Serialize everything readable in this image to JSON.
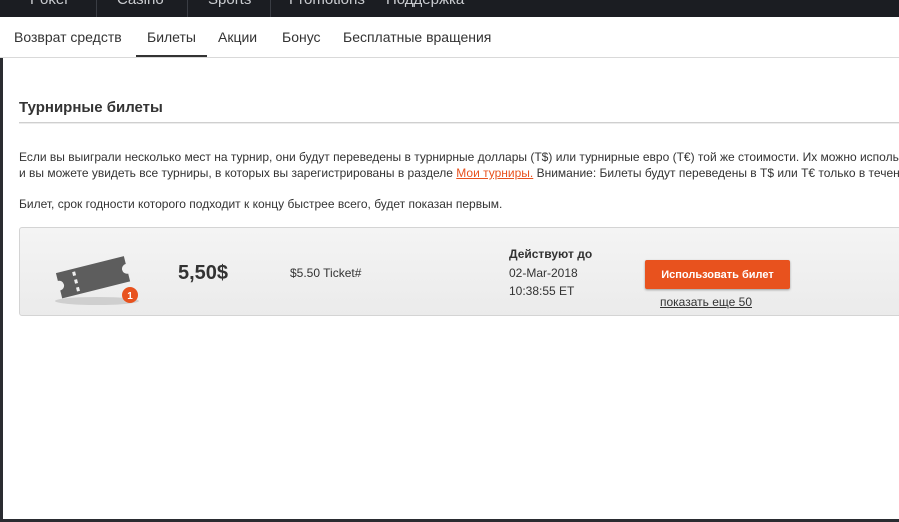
{
  "top_nav": {
    "items": [
      "Poker",
      "Casino",
      "Sports",
      "Promotions",
      "Поддержка"
    ]
  },
  "tabs": [
    {
      "label": "Возврат средств",
      "active": false
    },
    {
      "label": "Билеты",
      "active": true
    },
    {
      "label": "Акции",
      "active": false
    },
    {
      "label": "Бонус",
      "active": false
    },
    {
      "label": "Бесплатные вращения",
      "active": false
    }
  ],
  "section": {
    "title": "Турнирные билеты",
    "desc_line1": "Если вы выиграли несколько мест на турнир, они будут переведены в турнирные доллары (T$) или турнирные евро (T€) той же стоимости. Их можно использовать",
    "desc_line2_pre": "и вы можете увидеть все турниры, в которых вы зарегистрированы в разделе ",
    "desc_line2_link": "Мои турниры.",
    "desc_line2_post": " Внимание: Билеты будут переведены в T$ или T€ только в течение",
    "desc_note": "Билет, срок годности которого подходит к концу быстрее всего, будет показан первым."
  },
  "ticket": {
    "badge_count": "1",
    "amount": "5,50$",
    "name": "$5.50 Ticket#",
    "valid_label": "Действуют до",
    "valid_date": "02-Мar-2018",
    "valid_time": "10:38:55 ET",
    "use_button": "Использовать билет",
    "show_more": "показать еще 50"
  },
  "colors": {
    "accent": "#e8521e",
    "top_nav_bg": "#1b1d22",
    "card_bg": "#efefef"
  }
}
